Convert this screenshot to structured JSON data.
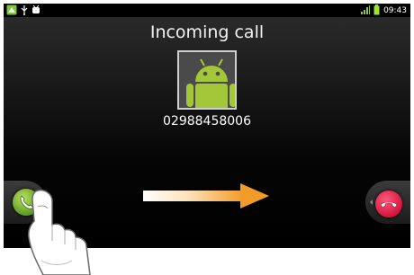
{
  "status_bar": {
    "time": "09:43",
    "icons_left": [
      "app-notification-icon",
      "usb-icon",
      "usb-debug-icon"
    ],
    "icons_right": [
      "signal-icon",
      "battery-icon"
    ]
  },
  "call": {
    "title": "Incoming call",
    "number": "02988458006",
    "avatar_icon": "android-robot-icon"
  },
  "controls": {
    "answer_icon": "phone-answer-icon",
    "decline_icon": "phone-decline-icon",
    "swipe_hint_icon": "swipe-arrow-icon"
  },
  "colors": {
    "answer": "#5d9b1f",
    "decline": "#d4143e",
    "arrow": "#f29b28",
    "android_green": "#9fc43a"
  }
}
